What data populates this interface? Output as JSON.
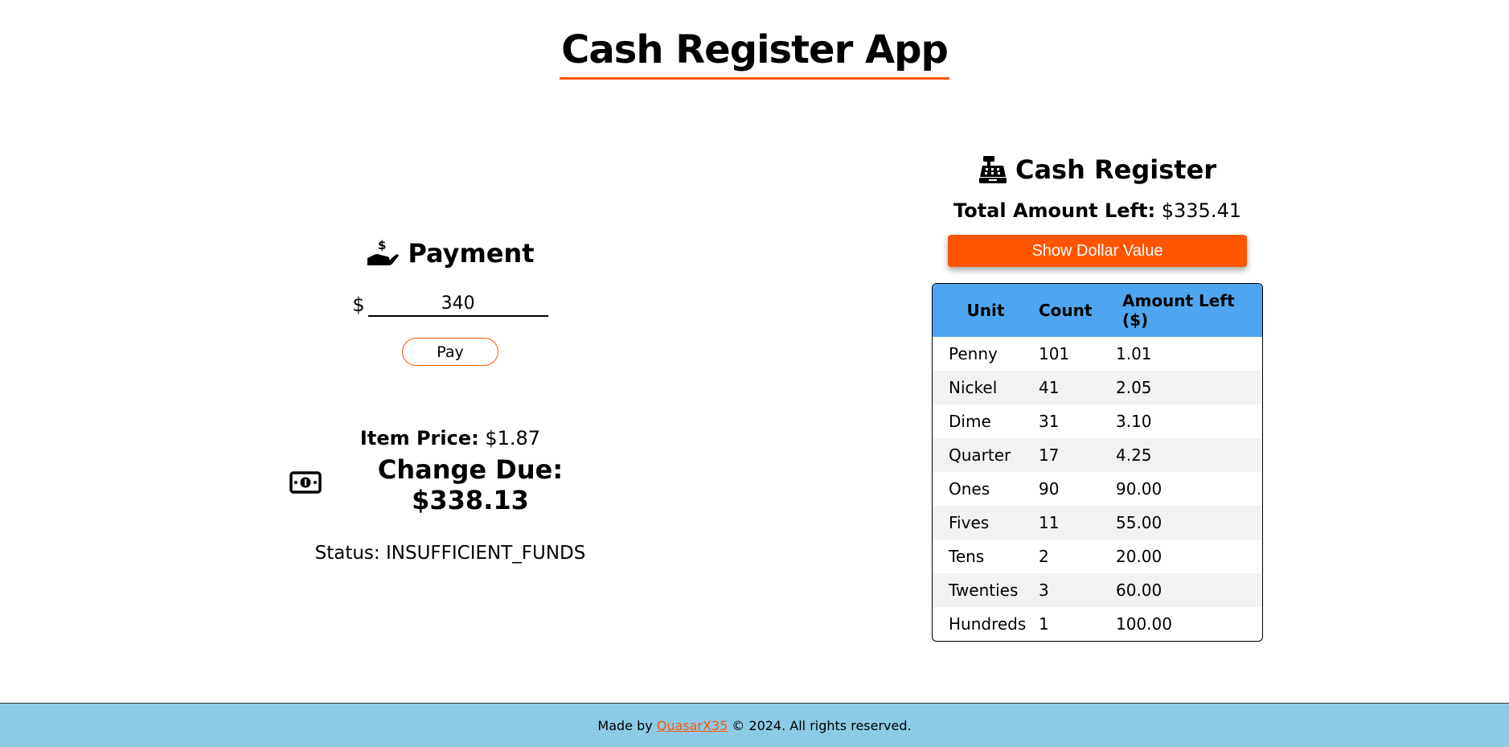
{
  "app": {
    "title": "Cash Register App"
  },
  "payment": {
    "heading": "Payment",
    "currency_symbol": "$",
    "input_value": "340",
    "pay_label": "Pay",
    "item_price_label": "Item Price:",
    "item_price_value": "$1.87",
    "change_due_text": "Change Due: $338.13",
    "status_text": "Status: INSUFFICIENT_FUNDS"
  },
  "register": {
    "heading": "Cash Register",
    "total_left_label": "Total Amount Left:",
    "total_left_value": "$335.41",
    "show_dollar_label": "Show Dollar Value",
    "table": {
      "headers": [
        "Unit",
        "Count",
        "Amount Left ($)"
      ],
      "rows": [
        [
          "Penny",
          "101",
          "1.01"
        ],
        [
          "Nickel",
          "41",
          "2.05"
        ],
        [
          "Dime",
          "31",
          "3.10"
        ],
        [
          "Quarter",
          "17",
          "4.25"
        ],
        [
          "Ones",
          "90",
          "90.00"
        ],
        [
          "Fives",
          "11",
          "55.00"
        ],
        [
          "Tens",
          "2",
          "20.00"
        ],
        [
          "Twenties",
          "3",
          "60.00"
        ],
        [
          "Hundreds",
          "1",
          "100.00"
        ]
      ]
    }
  },
  "footer": {
    "prefix": "Made by",
    "author_link": "QuasarX35",
    "suffix": "© 2024. All rights reserved."
  },
  "colors": {
    "accent": "#ff5500",
    "table_header": "#4fa6f0",
    "footer_bg": "#8ccae6"
  },
  "icons": {
    "payment": "hand-holding-dollar-icon",
    "register": "cash-register-icon",
    "change": "money-bill-icon"
  }
}
